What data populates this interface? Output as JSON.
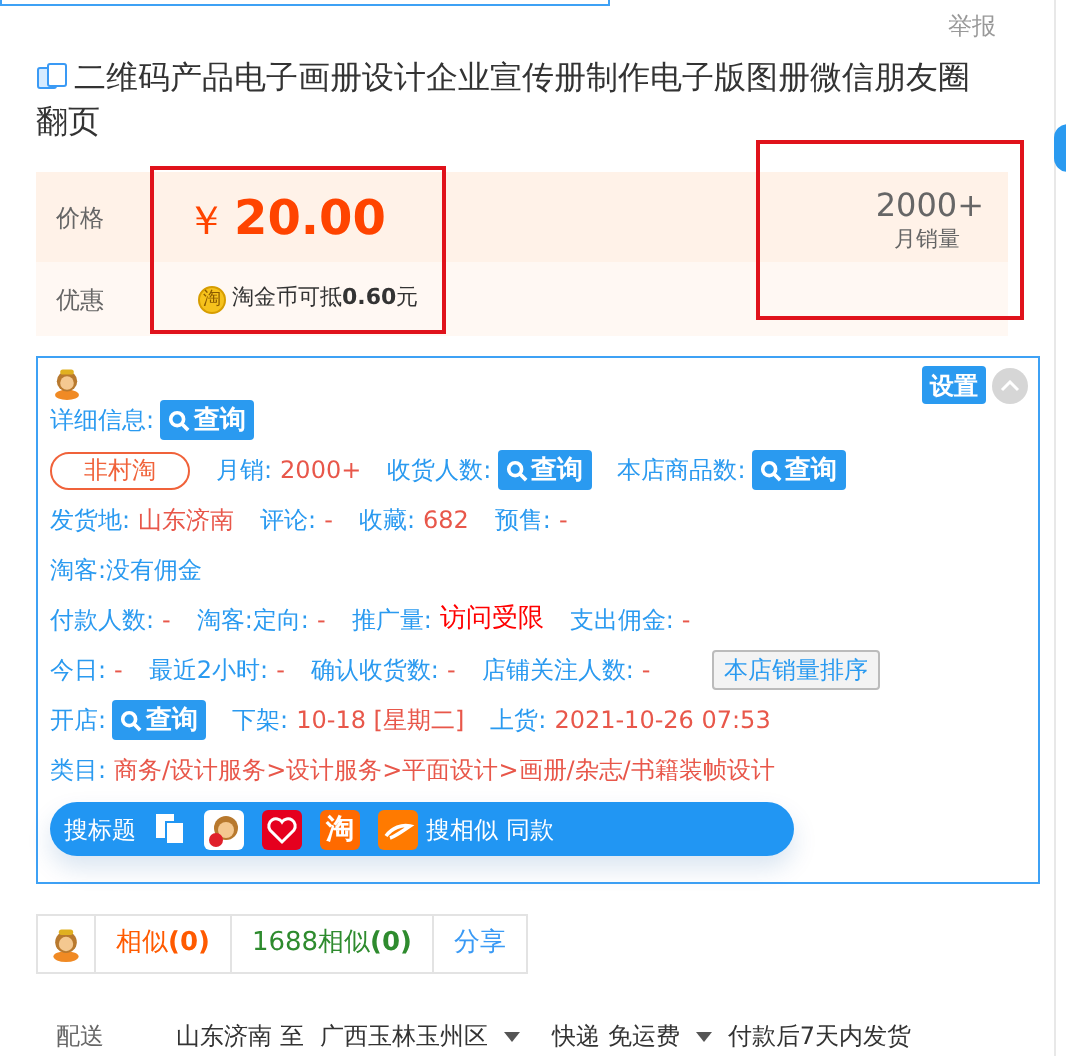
{
  "report_link": "举报",
  "title": "二维码产品电子画册设计企业宣传册制作电子版图册微信朋友圈翻页",
  "price": {
    "label": "价格",
    "currency": "￥",
    "amount": "20.00"
  },
  "promo": {
    "label": "优惠",
    "coin": "淘",
    "text": "淘金币可抵**0.60**元"
  },
  "sales": {
    "count": "2000+",
    "label": "月销量"
  },
  "plugin": {
    "settings_button": "设置",
    "rows": [
      [
        {
          "kind": "query",
          "label": "详细信息:",
          "button": "查询"
        }
      ],
      [
        {
          "kind": "badge",
          "text": "非村淘"
        },
        {
          "kind": "field",
          "label": "月销:",
          "value": "2000+",
          "alert": false
        },
        {
          "kind": "query",
          "label": "收货人数:",
          "button": "查询"
        },
        {
          "kind": "query",
          "label": "本店商品数:",
          "button": "查询"
        }
      ],
      [
        {
          "kind": "field",
          "label": "发货地:",
          "value": "山东济南",
          "alert": false
        },
        {
          "kind": "field",
          "label": "评论:",
          "value": "-",
          "alert": false
        },
        {
          "kind": "field",
          "label": "收藏:",
          "value": "682",
          "alert": false
        },
        {
          "kind": "field",
          "label": "预售:",
          "value": "-",
          "alert": false
        }
      ],
      [
        {
          "kind": "text",
          "text": "淘客:没有佣金"
        }
      ],
      [
        {
          "kind": "field",
          "label": "付款人数:",
          "value": "-",
          "alert": false
        },
        {
          "kind": "field",
          "label": "淘客:定向:",
          "value": "-",
          "alert": false
        },
        {
          "kind": "field",
          "label": "推广量:",
          "value": "访问受限",
          "alert": true
        },
        {
          "kind": "field",
          "label": "支出佣金:",
          "value": "-",
          "alert": false
        }
      ],
      [
        {
          "kind": "field",
          "label": "今日:",
          "value": "-",
          "alert": false
        },
        {
          "kind": "field",
          "label": "最近2小时:",
          "value": "-",
          "alert": false
        },
        {
          "kind": "field",
          "label": "确认收货数:",
          "value": "-",
          "alert": false
        },
        {
          "kind": "field",
          "label": "店铺关注人数:",
          "value": "-",
          "alert": false
        },
        {
          "kind": "button",
          "text": "本店销量排序"
        }
      ],
      [
        {
          "kind": "query",
          "label": "开店:",
          "button": "查询"
        },
        {
          "kind": "field",
          "label": "下架:",
          "value": "10-18 [星期二]",
          "alert": false
        },
        {
          "kind": "field",
          "label": "上货:",
          "value": "2021-10-26 07:53",
          "alert": false
        }
      ],
      [
        {
          "kind": "field",
          "label": "类目:",
          "value": "商务/设计服务>设计服务>平面设计>画册/杂志/书籍装帧设计",
          "alert": false
        }
      ]
    ],
    "toolbar": {
      "search_title": "搜标题",
      "taobao_icon": "淘",
      "similar": "搜相似 同款"
    }
  },
  "tabs": [
    {
      "label": "相似",
      "count": "(0)",
      "kind": "orange"
    },
    {
      "label": "1688相似",
      "count": "(0)",
      "kind": "green"
    },
    {
      "label": "分享",
      "kind": "blue"
    }
  ],
  "delivery": {
    "label": "配送",
    "from": "山东济南",
    "to_word": "至",
    "to": "广西玉林玉州区",
    "method": "快递 免运费",
    "time": "付款后7天内发货"
  }
}
